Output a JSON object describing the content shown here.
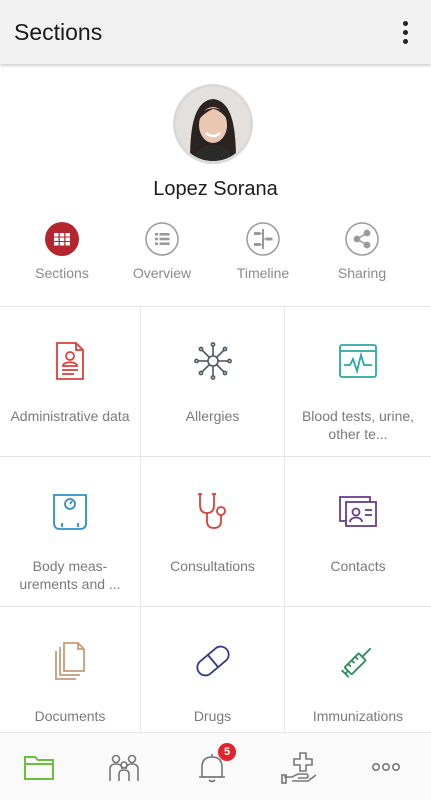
{
  "appbar": {
    "title": "Sections"
  },
  "profile": {
    "name": "Lopez Sorana"
  },
  "views": [
    {
      "label": "Sections",
      "icon": "grid-icon",
      "active": true
    },
    {
      "label": "Overview",
      "icon": "list-icon"
    },
    {
      "label": "Timeline",
      "icon": "timeline-icon"
    },
    {
      "label": "Sharing",
      "icon": "share-icon"
    }
  ],
  "sections": [
    {
      "label": "Administrative data",
      "icon": "administrative-document-icon",
      "color": "#d9413a"
    },
    {
      "label": "Allergies",
      "icon": "allergen-icon",
      "color": "#4a5a66"
    },
    {
      "label": "Blood tests, urine, other te...",
      "icon": "heart-monitor-icon",
      "color": "#2aa8a2"
    },
    {
      "label": "Body meas- urements and ...",
      "icon": "weight-scale-icon",
      "color": "#2f8fc4"
    },
    {
      "label": "Consultations",
      "icon": "stethoscope-icon",
      "color": "#d9413a"
    },
    {
      "label": "Contacts",
      "icon": "contact-card-icon",
      "color": "#6a3c8c"
    },
    {
      "label": "Documents",
      "icon": "documents-icon",
      "color": "#c79a78"
    },
    {
      "label": "Drugs",
      "icon": "pill-icon",
      "color": "#2d3b8a"
    },
    {
      "label": "Immunizations",
      "icon": "syringe-icon",
      "color": "#2b8a5a"
    }
  ],
  "bottom_nav": {
    "items": [
      "folder-icon",
      "family-icon",
      "bell-icon",
      "medical-hand-icon",
      "more-icon"
    ],
    "notification_count": "5",
    "active_color": "#6cbf3a"
  }
}
